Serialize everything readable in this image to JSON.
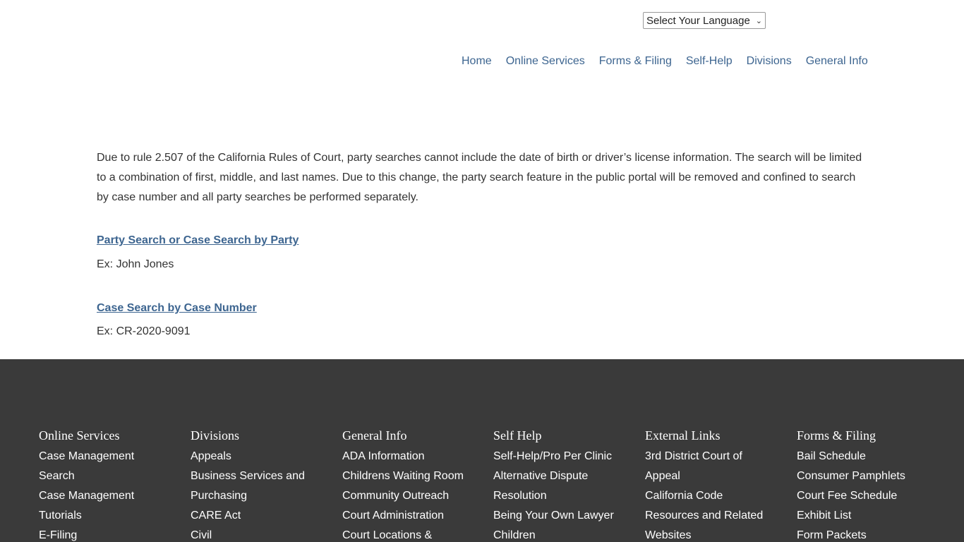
{
  "language": {
    "label": "Select Your Language"
  },
  "nav": [
    "Home",
    "Online Services",
    "Forms & Filing",
    "Self-Help",
    "Divisions",
    "General Info"
  ],
  "notice": "Due to rule 2.507 of the California Rules of Court, party searches cannot include the date of birth or driver’s license information. The search will be limited to a combination of first, middle, and last names. Due to this change, the party search feature in the public portal will be removed and confined to search by case number and all party searches be performed separately.",
  "party_search": {
    "label": "Party Search or Case Search by Party",
    "example": "Ex: John Jones"
  },
  "case_search": {
    "label": "Case Search by Case Number",
    "example": "Ex: CR-2020-9091"
  },
  "footer": {
    "columns": [
      {
        "title": "Online Services",
        "links": [
          "Case Management",
          "Search",
          "Case Management",
          "Tutorials",
          "E-Filing"
        ]
      },
      {
        "title": "Divisions",
        "links": [
          "Appeals",
          "Business Services and",
          "Purchasing",
          "CARE Act",
          "Civil"
        ]
      },
      {
        "title": "General Info",
        "links": [
          "ADA Information",
          "Childrens Waiting Room",
          "Community Outreach",
          "Court Administration",
          "Court Locations &"
        ]
      },
      {
        "title": "Self Help",
        "links": [
          "Self-Help/Pro Per Clinic",
          "Alternative Dispute",
          "Resolution",
          "Being Your Own Lawyer",
          "Children"
        ]
      },
      {
        "title": "External Links",
        "links": [
          "3rd District Court of",
          "Appeal",
          "California Code",
          "Resources and Related",
          "Websites"
        ]
      },
      {
        "title": "Forms & Filing",
        "links": [
          "Bail Schedule",
          "Consumer Pamphlets",
          "Court Fee Schedule",
          "Exhibit List",
          "Form Packets"
        ]
      }
    ]
  }
}
